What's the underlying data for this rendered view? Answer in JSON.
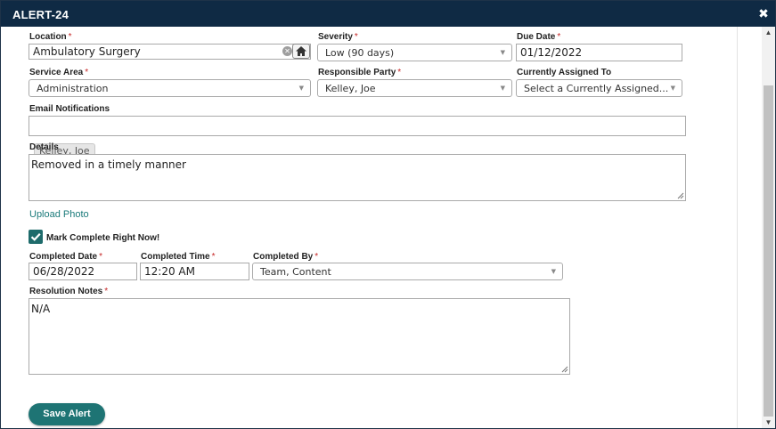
{
  "window": {
    "title": "ALERT-24",
    "close_glyph": "✖"
  },
  "form": {
    "location": {
      "label": "Location",
      "value": "Ambulatory Surgery",
      "clear_glyph": "✕"
    },
    "severity": {
      "label": "Severity",
      "value": "Low (90 days)"
    },
    "due_date": {
      "label": "Due Date",
      "value": "01/12/2022"
    },
    "service_area": {
      "label": "Service Area",
      "value": "Administration"
    },
    "responsible_party": {
      "label": "Responsible Party",
      "value": "Kelley, Joe"
    },
    "currently_assigned": {
      "label": "Currently Assigned To",
      "value": "Select a Currently Assigned..."
    },
    "email_notifications": {
      "label": "Email Notifications",
      "tags": [
        "Kelley, Joe"
      ]
    },
    "details": {
      "label": "Details",
      "value": "Removed in a timely manner"
    },
    "upload_photo": {
      "label": "Upload Photo"
    },
    "mark_complete": {
      "label": "Mark Complete Right Now!",
      "checked": true
    },
    "completed_date": {
      "label": "Completed Date",
      "value": "06/28/2022"
    },
    "completed_time": {
      "label": "Completed Time",
      "value": "12:20 AM"
    },
    "completed_by": {
      "label": "Completed By",
      "value": "Team, Content"
    },
    "resolution_notes": {
      "label": "Resolution Notes",
      "value": "N/A"
    },
    "required_marker": "*"
  },
  "actions": {
    "save_label": "Save Alert"
  },
  "colors": {
    "titlebar": "#0f2a44",
    "accent": "#1e7474",
    "link": "#1a7a7a",
    "required": "#c62828"
  },
  "icons": {
    "home": "home-icon",
    "close": "close-icon",
    "clear": "clear-icon",
    "caret": "caret-down-icon",
    "check": "checkmark-icon"
  }
}
